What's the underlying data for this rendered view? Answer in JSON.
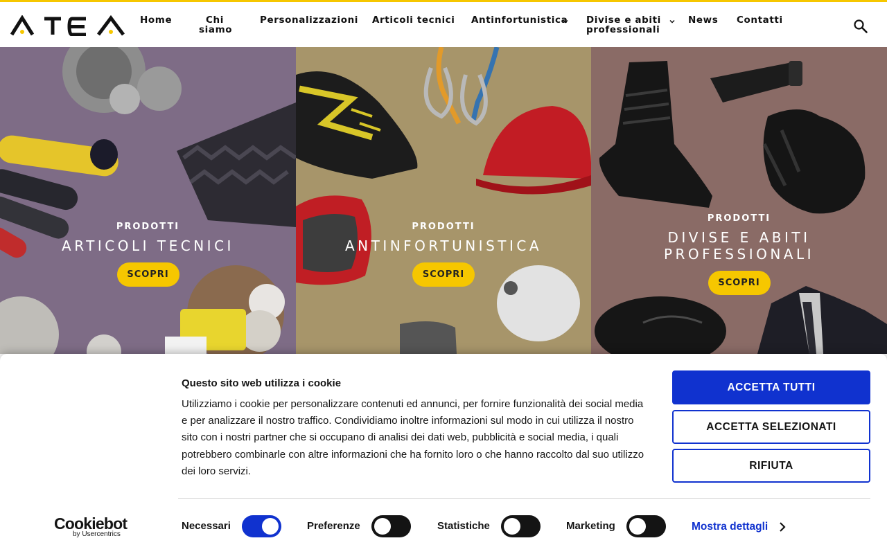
{
  "brand": {
    "logo_text": "ATEA",
    "accent": "#f6c700"
  },
  "nav": {
    "home": "Home",
    "chi_l1": "Chi",
    "chi_l2": "siamo",
    "personalizzazioni": "Personalizzazioni",
    "articoli": "Articoli tecnici",
    "antinfortunistica": "Antinfortunistica",
    "divise_l1": "Divise e abiti",
    "divise_l2": "professionali",
    "news": "News",
    "contatti": "Contatti",
    "search_icon": "search-icon"
  },
  "hero": [
    {
      "eyebrow": "PRODOTTI",
      "title": "ARTICOLI TECNICI",
      "cta": "SCOPRI",
      "bg": "#7e6c86"
    },
    {
      "eyebrow": "PRODOTTI",
      "title": "ANTINFORTUNISTICA",
      "cta": "SCOPRI",
      "bg": "#a7956a"
    },
    {
      "eyebrow": "PRODOTTI",
      "title_l1": "DIVISE E ABITI",
      "title_l2": "PROFESSIONALI",
      "cta": "SCOPRI",
      "bg": "#8a6b66"
    }
  ],
  "cookie": {
    "title": "Questo sito web utilizza i cookie",
    "body": "Utilizziamo i cookie per personalizzare contenuti ed annunci, per fornire funzionalità dei social media e per analizzare il nostro traffico. Condividiamo inoltre informazioni sul modo in cui utilizza il nostro sito con i nostri partner che si occupano di analisi dei dati web, pubblicità e social media, i quali potrebbero combinarle con altre informazioni che ha fornito loro o che hanno raccolto dal suo utilizzo dei loro servizi.",
    "accept_all": "ACCETTA TUTTI",
    "accept_selected": "ACCETTA SELEZIONATI",
    "reject": "RIFIUTA",
    "provider": "Cookiebot",
    "provider_sub": "by Usercentrics",
    "toggles": [
      {
        "label": "Necessari",
        "on": true
      },
      {
        "label": "Preferenze",
        "on": false
      },
      {
        "label": "Statistiche",
        "on": false
      },
      {
        "label": "Marketing",
        "on": false
      }
    ],
    "details": "Mostra dettagli",
    "primary_color": "#1032cf"
  }
}
